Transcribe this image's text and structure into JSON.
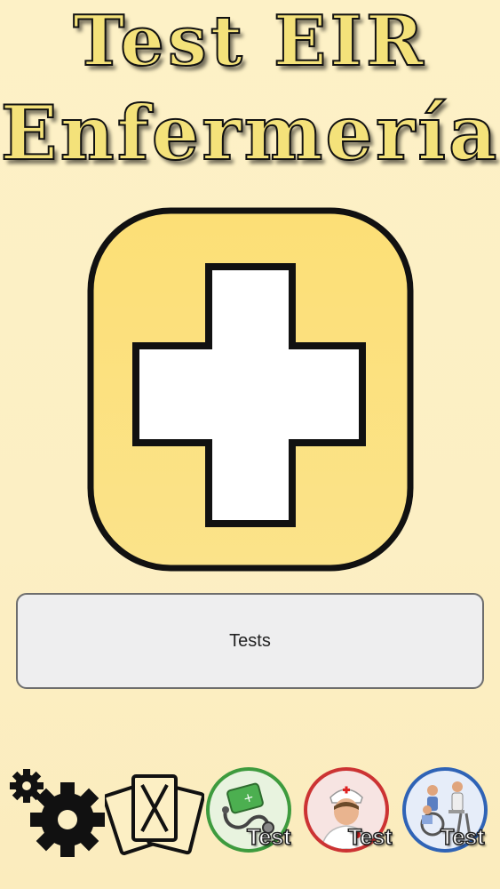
{
  "app": {
    "title_line1": "Test EIR",
    "title_line2": "Enfermería"
  },
  "main": {
    "tests_button_label": "Tests"
  },
  "bottom_bar": {
    "items": [
      {
        "icon": "gear-icon"
      },
      {
        "icon": "cards-icon"
      },
      {
        "icon": "nurse-kit-icon",
        "label": "Test",
        "accent": "#3e9b3e"
      },
      {
        "icon": "nurse-icon",
        "label": "Test",
        "accent": "#cc3333"
      },
      {
        "icon": "elderly-care-icon",
        "label": "Test",
        "accent": "#2f63b6"
      }
    ]
  },
  "colors": {
    "background": "#fdf1c6",
    "logo_fill": "#fce07b",
    "title_fill": "#f4e27a"
  }
}
